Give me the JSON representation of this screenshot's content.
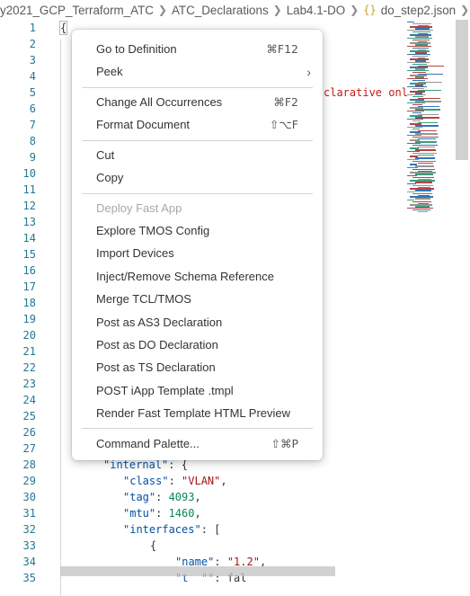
{
  "breadcrumb": {
    "items": [
      "y2021_GCP_Terraform_ATC",
      "ATC_Declarations",
      "Lab4.1-DO"
    ],
    "file_icon": "{}",
    "file": "do_step2.json",
    "ellipsis": "..."
  },
  "gutter": {
    "lines": [
      "1",
      "2",
      "3",
      "4",
      "5",
      "6",
      "7",
      "8",
      "9",
      "10",
      "11",
      "12",
      "13",
      "14",
      "15",
      "16",
      "17",
      "18",
      "19",
      "20",
      "21",
      "22",
      "23",
      "24",
      "25",
      "26",
      "27",
      "28",
      "29",
      "30",
      "31",
      "32",
      "33",
      "34",
      "35"
    ]
  },
  "code": {
    "line1": "{",
    "line5_fragment": "clarative onl",
    "line28": {
      "key": "\"internal\"",
      "rest": ": {"
    },
    "line29": {
      "key": "\"class\"",
      "sep": ": ",
      "value": "\"VLAN\"",
      "end": ","
    },
    "line30": {
      "key": "\"tag\"",
      "sep": ": ",
      "value": "4093",
      "end": ","
    },
    "line31": {
      "key": "\"mtu\"",
      "sep": ": ",
      "value": "1460",
      "end": ","
    },
    "line32": {
      "key": "\"interfaces\"",
      "rest": ": ["
    },
    "line33": "{",
    "line34": {
      "key": "\"name\"",
      "sep": ": ",
      "value": "\"1.2\"",
      "end": ","
    },
    "line35": {
      "key": "\"t",
      "rest": "  \"\": fal"
    }
  },
  "colors": {
    "accent_key": "#0451a5",
    "string": "#a31515",
    "number": "#098658",
    "line_number": "#237893"
  },
  "context_menu": {
    "items": [
      {
        "label": "Go to Definition",
        "shortcut": "⌘F12"
      },
      {
        "label": "Peek",
        "submenu_icon": "chevron-right-icon"
      },
      {
        "label": "Change All Occurrences",
        "shortcut": "⌘F2"
      },
      {
        "label": "Format Document",
        "shortcut": "⇧⌥F"
      },
      {
        "label": "Cut"
      },
      {
        "label": "Copy"
      },
      {
        "label": "Deploy Fast App",
        "disabled": true
      },
      {
        "label": "Explore TMOS Config"
      },
      {
        "label": "Import Devices"
      },
      {
        "label": "Inject/Remove Schema Reference"
      },
      {
        "label": "Merge TCL/TMOS"
      },
      {
        "label": "Post as AS3 Declaration"
      },
      {
        "label": "Post as DO Declaration"
      },
      {
        "label": "Post as TS Declaration"
      },
      {
        "label": "POST iApp Template .tmpl"
      },
      {
        "label": "Render Fast Template HTML Preview"
      },
      {
        "label": "Command Palette...",
        "shortcut": "⇧⌘P"
      }
    ]
  }
}
